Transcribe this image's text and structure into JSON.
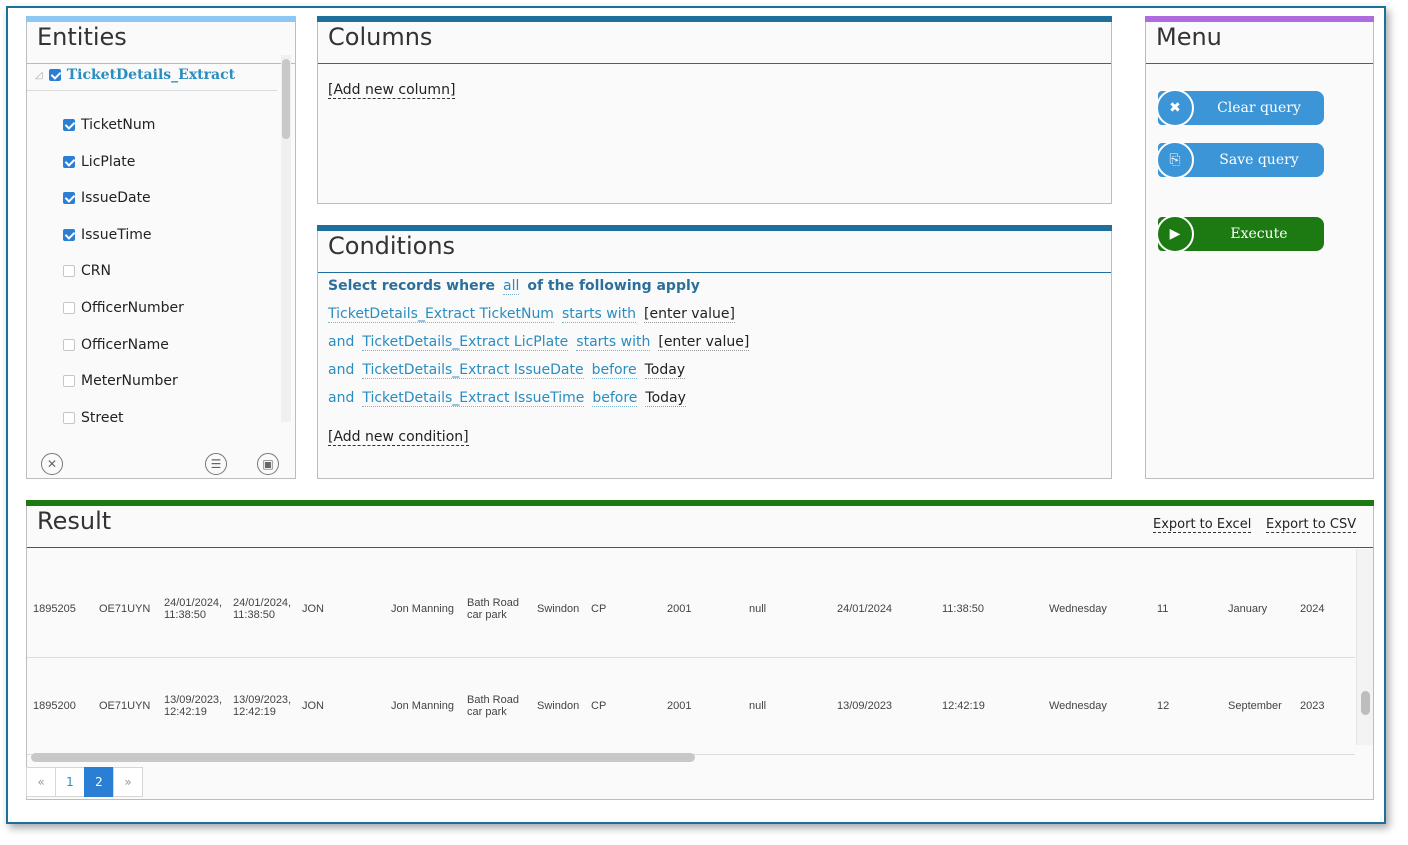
{
  "colors": {
    "entities_bar": "#8dc8f2",
    "columns_bar": "#1f6f9c",
    "menu_bar": "#b06be0",
    "result_bar": "#1d7a12",
    "link": "#2a8dc1",
    "btn_blue": "#3c95d6",
    "btn_green": "#1d7a12"
  },
  "entities": {
    "title": "Entities",
    "root": {
      "label": "TicketDetails_Extract",
      "checked": true
    },
    "fields": [
      {
        "label": "TicketNum",
        "checked": true
      },
      {
        "label": "LicPlate",
        "checked": true
      },
      {
        "label": "IssueDate",
        "checked": true
      },
      {
        "label": "IssueTime",
        "checked": true
      },
      {
        "label": "CRN",
        "checked": false
      },
      {
        "label": "OfficerNumber",
        "checked": false
      },
      {
        "label": "OfficerName",
        "checked": false
      },
      {
        "label": "MeterNumber",
        "checked": false
      },
      {
        "label": "Street",
        "checked": false
      }
    ],
    "footer_icons": [
      "clear-icon",
      "list-icon",
      "table-icon"
    ]
  },
  "columns": {
    "title": "Columns",
    "add_label": "[Add new column]"
  },
  "conditions": {
    "title": "Conditions",
    "header": {
      "prefix": "Select records where",
      "mode": "all",
      "suffix": "of the following apply"
    },
    "rows": [
      {
        "conj": "",
        "field": "TicketDetails_Extract TicketNum",
        "op": "starts with",
        "value": "[enter value]"
      },
      {
        "conj": "and",
        "field": "TicketDetails_Extract LicPlate",
        "op": "starts with",
        "value": "[enter value]"
      },
      {
        "conj": "and",
        "field": "TicketDetails_Extract IssueDate",
        "op": "before",
        "value": "Today"
      },
      {
        "conj": "and",
        "field": "TicketDetails_Extract IssueTime",
        "op": "before",
        "value": "Today"
      }
    ],
    "add_label": "[Add new condition]"
  },
  "menu": {
    "title": "Menu",
    "clear": "Clear query",
    "save": "Save query",
    "execute": "Execute"
  },
  "result": {
    "title": "Result",
    "export_excel": "Export to Excel",
    "export_csv": "Export to CSV",
    "rows": [
      [
        "1895205",
        "OE71UYN",
        "24/01/2024,\n11:38:50",
        "24/01/2024,\n11:38:50",
        "JON",
        "Jon Manning",
        "Bath Road\ncar park",
        "Swindon",
        "CP",
        "2001",
        "null",
        "24/01/2024",
        "11:38:50",
        "Wednesday",
        "11",
        "January",
        "2024"
      ],
      [
        "1895200",
        "OE71UYN",
        "13/09/2023,\n12:42:19",
        "13/09/2023,\n12:42:19",
        "JON",
        "Jon Manning",
        "Bath Road\ncar park",
        "Swindon",
        "CP",
        "2001",
        "null",
        "13/09/2023",
        "12:42:19",
        "Wednesday",
        "12",
        "September",
        "2023"
      ]
    ],
    "pager": {
      "prev": "«",
      "pages": [
        "1",
        "2"
      ],
      "current": "2",
      "next": "»"
    }
  }
}
